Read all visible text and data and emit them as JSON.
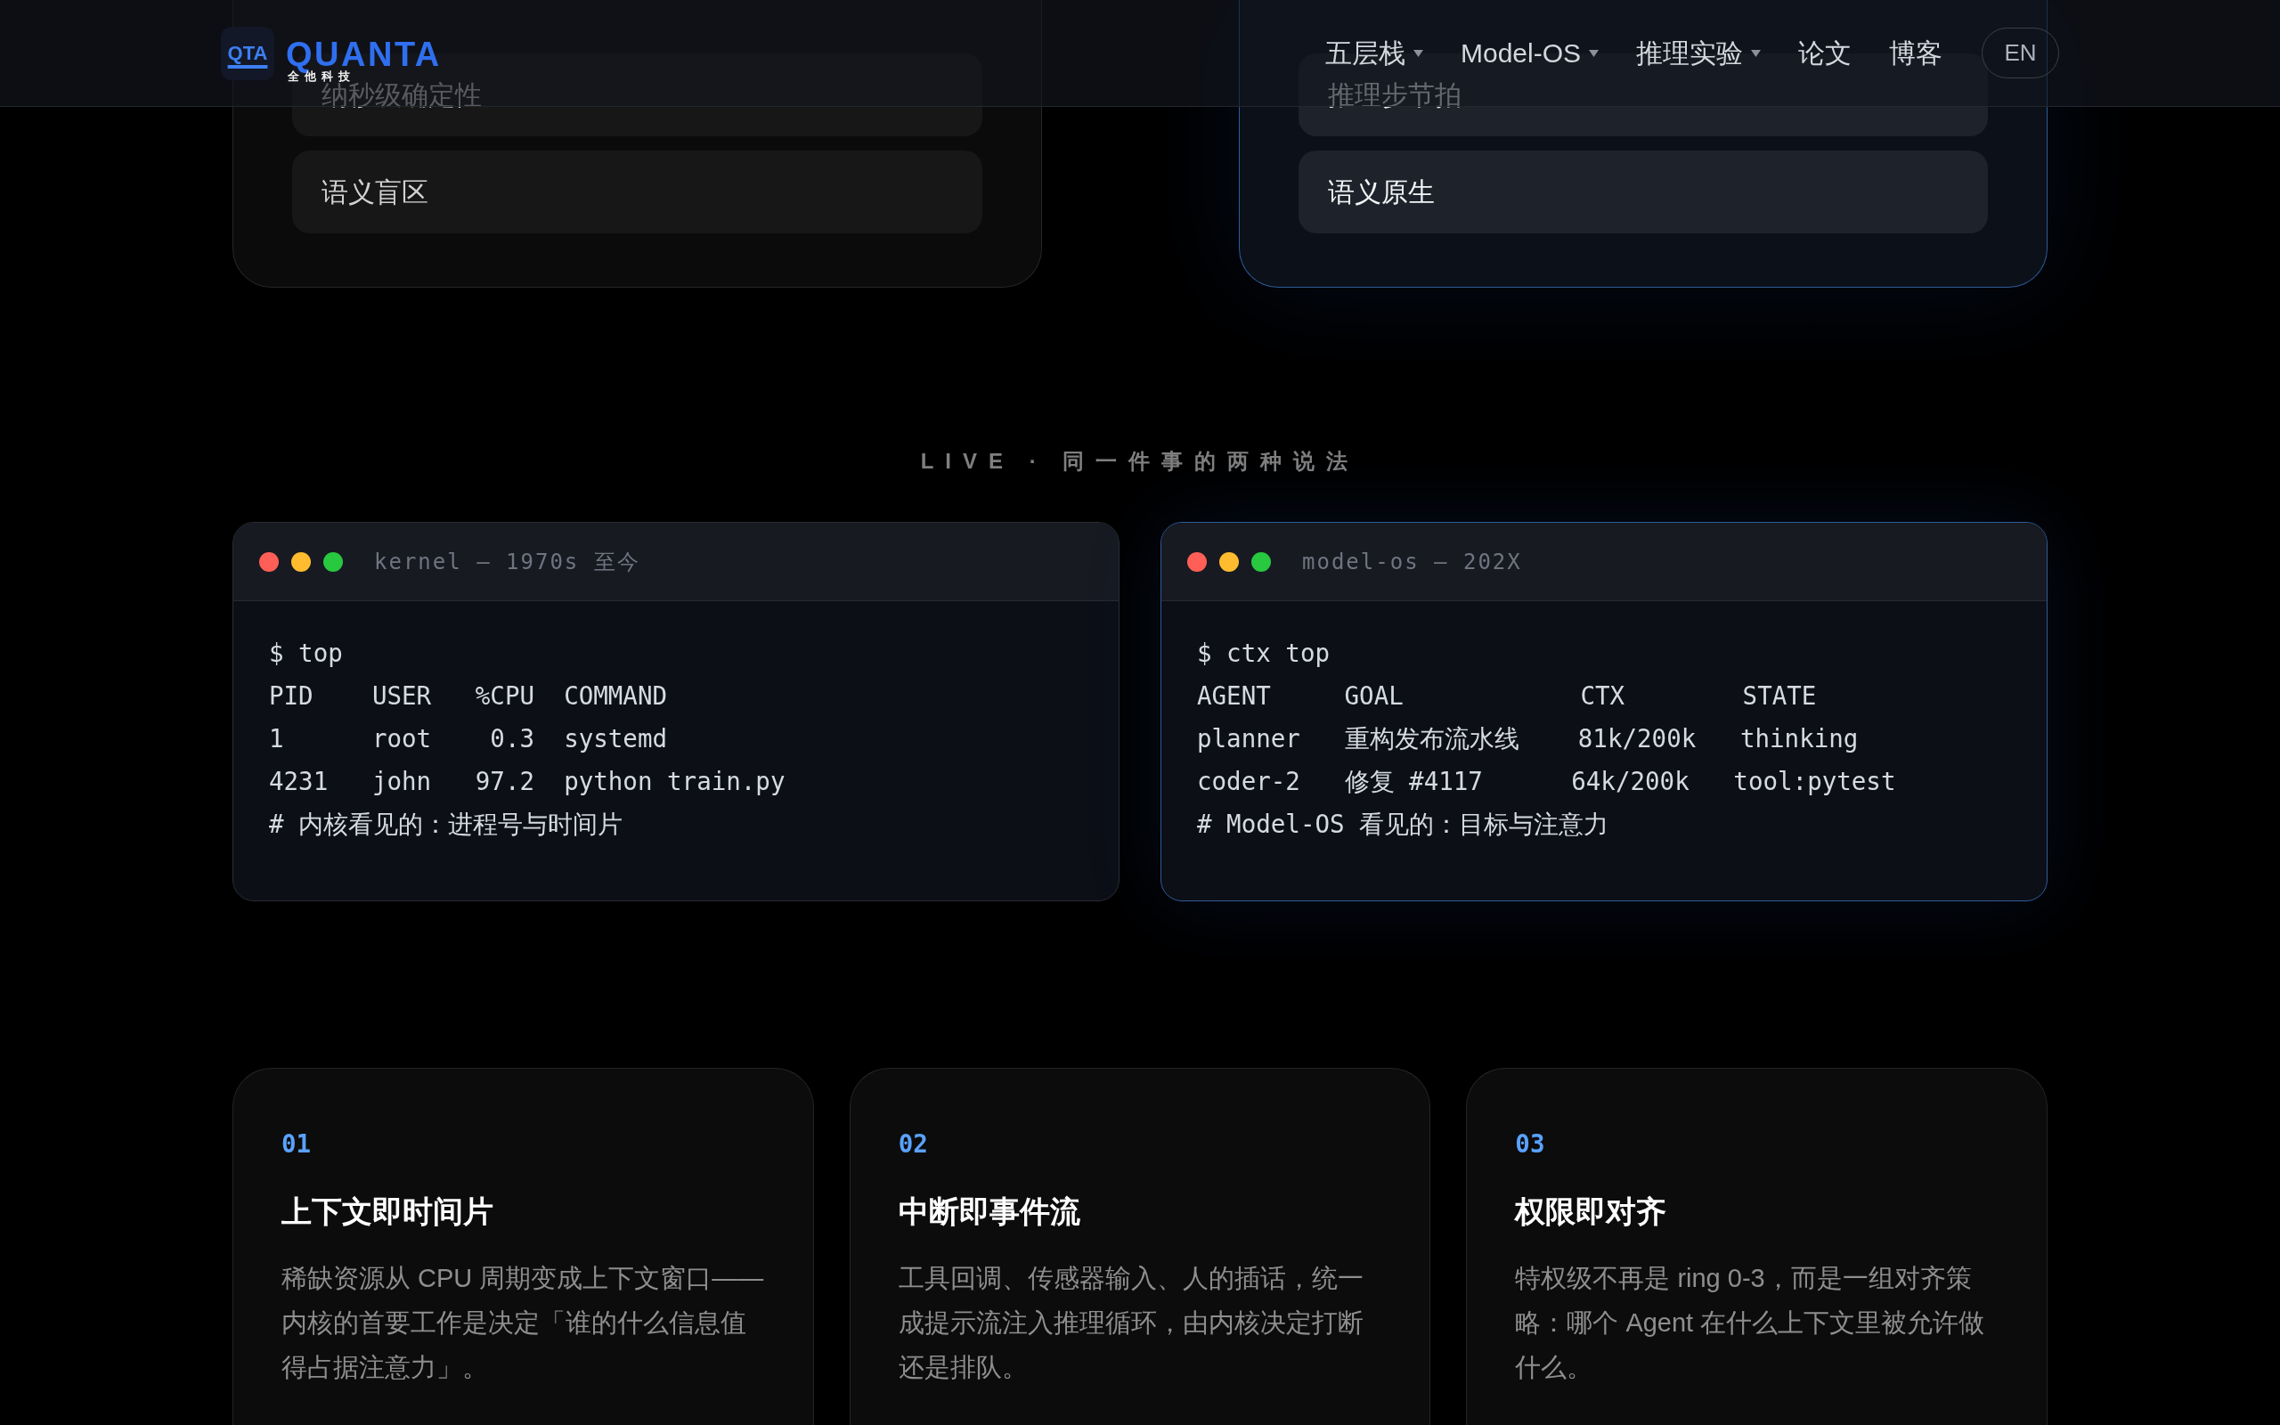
{
  "header": {
    "logo": {
      "badge": "QTA",
      "wordmark": "QUANTA",
      "tagline": "全他科技"
    },
    "nav": [
      {
        "label": "五层栈",
        "dropdown": true
      },
      {
        "label": "Model-OS",
        "dropdown": true
      },
      {
        "label": "推理实验",
        "dropdown": true
      },
      {
        "label": "论文",
        "dropdown": false
      },
      {
        "label": "博客",
        "dropdown": false
      }
    ],
    "language_button": "EN"
  },
  "comparison_cards": [
    {
      "highlighted": false,
      "items": [
        "纳秒级确定性",
        "语义盲区"
      ]
    },
    {
      "highlighted": true,
      "items": [
        "推理步节拍",
        "语义原生"
      ]
    }
  ],
  "live_section": {
    "label": "LIVE · 同一件事的两种说法",
    "terminals": [
      {
        "title": "kernel — 1970s 至今",
        "highlighted": false,
        "lines": [
          "$ top",
          "PID    USER   %CPU  COMMAND",
          "1      root    0.3  systemd",
          "4231   john   97.2  python train.py",
          "# 内核看见的：进程号与时间片"
        ]
      },
      {
        "title": "model-os — 202X",
        "highlighted": true,
        "lines": [
          "$ ctx top",
          "AGENT     GOAL            CTX        STATE",
          "planner   重构发布流水线    81k/200k   thinking",
          "coder-2   修复 #4117      64k/200k   tool:pytest",
          "# Model-OS 看见的：目标与注意力"
        ]
      }
    ]
  },
  "principles": [
    {
      "number": "01",
      "title": "上下文即时间片",
      "description": "稀缺资源从 CPU 周期变成上下文窗口——内核的首要工作是决定「谁的什么信息值得占据注意力」。"
    },
    {
      "number": "02",
      "title": "中断即事件流",
      "description": "工具回调、传感器输入、人的插话，统一成提示流注入推理循环，由内核决定打断还是排队。"
    },
    {
      "number": "03",
      "title": "权限即对齐",
      "description": "特权级不再是 ring 0-3，而是一组对齐策略：哪个 Agent 在什么上下文里被允许做什么。"
    }
  ]
}
